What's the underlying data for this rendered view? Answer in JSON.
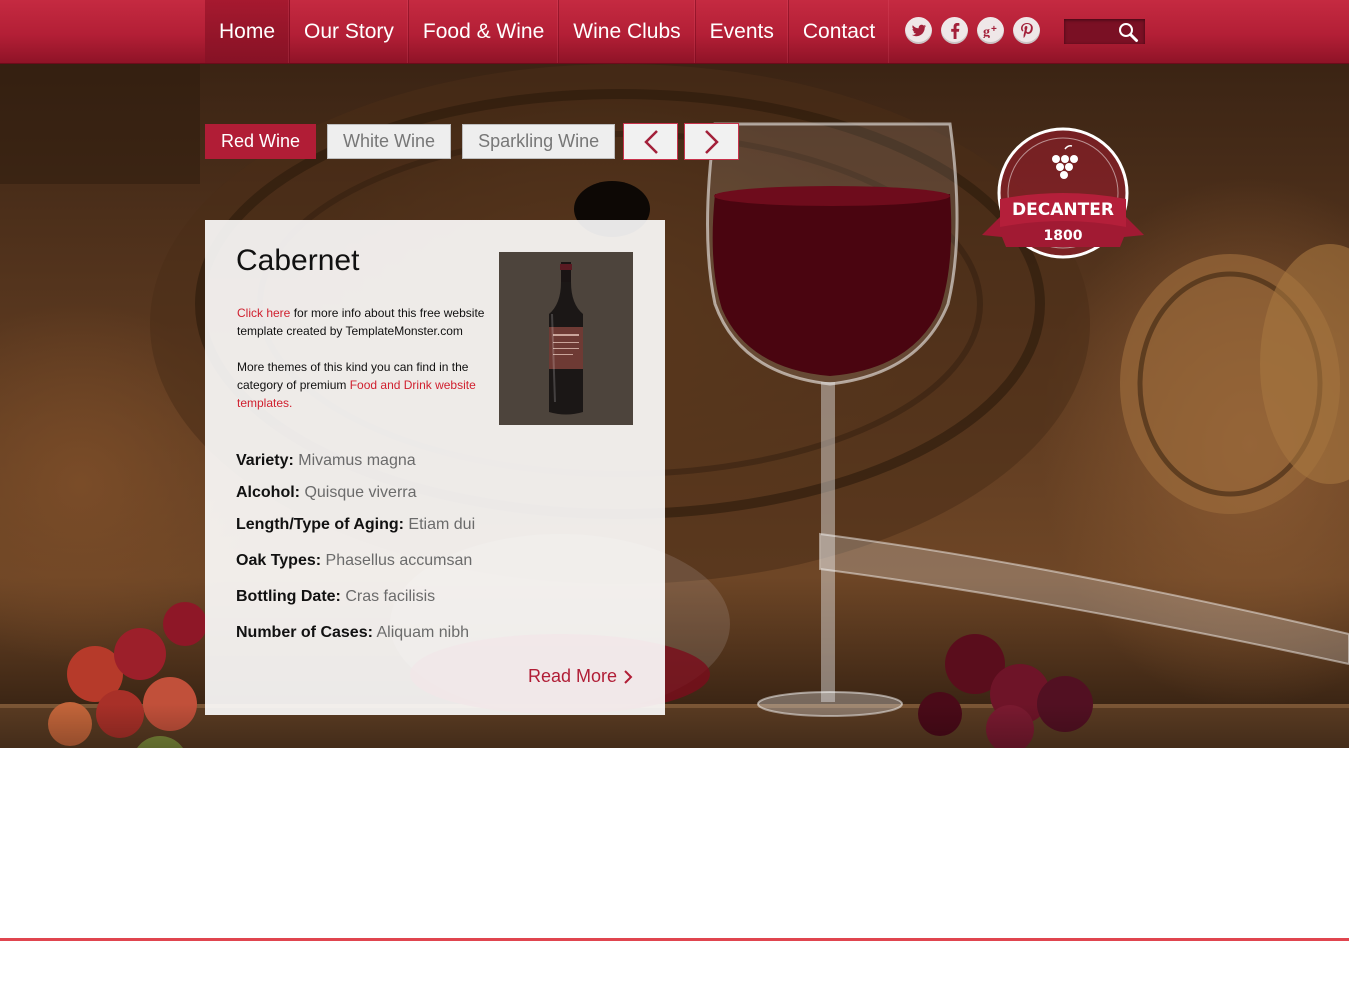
{
  "nav": {
    "items": [
      "Home",
      "Our Story",
      "Food & Wine",
      "Wine Clubs",
      "Events",
      "Contact"
    ],
    "active": "Home"
  },
  "social": [
    {
      "icon": "twitter-icon",
      "glyph": "t"
    },
    {
      "icon": "facebook-icon",
      "glyph": "f"
    },
    {
      "icon": "google-plus-icon",
      "glyph": "g+"
    },
    {
      "icon": "pinterest-icon",
      "glyph": "p"
    }
  ],
  "search": {
    "placeholder": "",
    "icon": "search-icon"
  },
  "tabs": {
    "red": "Red Wine",
    "white": "White Wine",
    "sparkling": "Sparkling Wine",
    "active": "Red Wine"
  },
  "logo": {
    "name": "DECANTER",
    "year": "1800"
  },
  "card": {
    "title": "Cabernet",
    "intro1_link": "Click here",
    "intro1_text": " for more info about this free website template created by TemplateMonster.com",
    "intro2_text": "More themes of this kind you can find in the category of premium ",
    "intro2_link": "Food and Drink website templates.",
    "specs": [
      {
        "label": "Variety:",
        "value": "Mivamus magna"
      },
      {
        "label": "Alcohol:",
        "value": "Quisque viverra"
      },
      {
        "label": "Length/Type of Aging:",
        "value": "Etiam dui"
      },
      {
        "label": "Oak Types:",
        "value": "Phasellus accumsan"
      },
      {
        "label": "Bottling Date:",
        "value": "Cras facilisis"
      },
      {
        "label": "Number of Cases:",
        "value": "Aliquam nibh"
      }
    ],
    "read_more": "Read More"
  },
  "colors": {
    "brand_red": "#b11d36",
    "link_red": "#d0202f",
    "divider": "#e0454f"
  }
}
